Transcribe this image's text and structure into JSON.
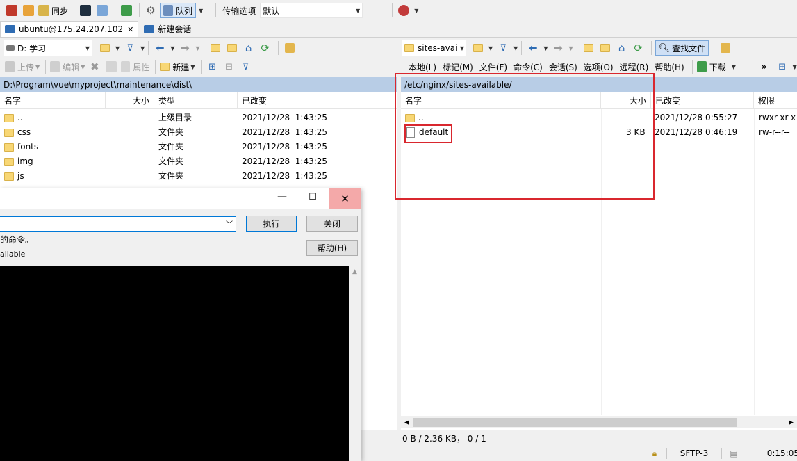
{
  "toolbar": {
    "sync_label": "同步",
    "queue_label": "队列",
    "transfer_label": "传输选项",
    "transfer_value": "默认"
  },
  "tabs": [
    {
      "label": "ubuntu@175.24.207.102",
      "close": "✕"
    },
    {
      "label": "新建会话"
    }
  ],
  "left": {
    "drive": "D: 学习",
    "upload": "上传",
    "edit": "编辑",
    "props": "属性",
    "new": "新建",
    "path": "D:\\Program\\vue\\myproject\\maintenance\\dist\\",
    "columns": {
      "name": "名字",
      "size": "大小",
      "type": "类型",
      "changed": "已改变"
    },
    "files": [
      {
        "name": "..",
        "size": "",
        "type": "上级目录",
        "changed": "2021/12/28  1:43:25"
      },
      {
        "name": "css",
        "size": "",
        "type": "文件夹",
        "changed": "2021/12/28  1:43:25"
      },
      {
        "name": "fonts",
        "size": "",
        "type": "文件夹",
        "changed": "2021/12/28  1:43:25"
      },
      {
        "name": "img",
        "size": "",
        "type": "文件夹",
        "changed": "2021/12/28  1:43:25"
      },
      {
        "name": "js",
        "size": "",
        "type": "文件夹",
        "changed": "2021/12/28  1:43:25"
      }
    ]
  },
  "right": {
    "dir": "sites-avai",
    "find_files": "查找文件",
    "menu": [
      "本地(L)",
      "标记(M)",
      "文件(F)",
      "命令(C)",
      "会话(S)",
      "选项(O)",
      "远程(R)",
      "帮助(H)"
    ],
    "download": "下载",
    "path": "/etc/nginx/sites-available/",
    "columns": {
      "name": "名字",
      "size": "大小",
      "changed": "已改变",
      "rights": "权限"
    },
    "files": [
      {
        "name": "..",
        "size": "",
        "changed": "2021/12/28 0:55:27",
        "rights": "rwxr-xr-x"
      },
      {
        "name": "default",
        "size": "3 KB",
        "changed": "2021/12/28 0:46:19",
        "rights": "rw-r--r--"
      }
    ],
    "status": "0 B / 2.36 KB，  0 / 1"
  },
  "dialog": {
    "execute": "执行",
    "close": "关闭",
    "help": "帮助(H)",
    "desc": "的命令。",
    "current_dir": "ailable"
  },
  "statusbar": {
    "protocol": "SFTP-3",
    "time": "0:15:05"
  },
  "colors": {
    "highlight": "#d9272e",
    "path_bg": "#b8cde6",
    "accent": "#0078d7"
  }
}
